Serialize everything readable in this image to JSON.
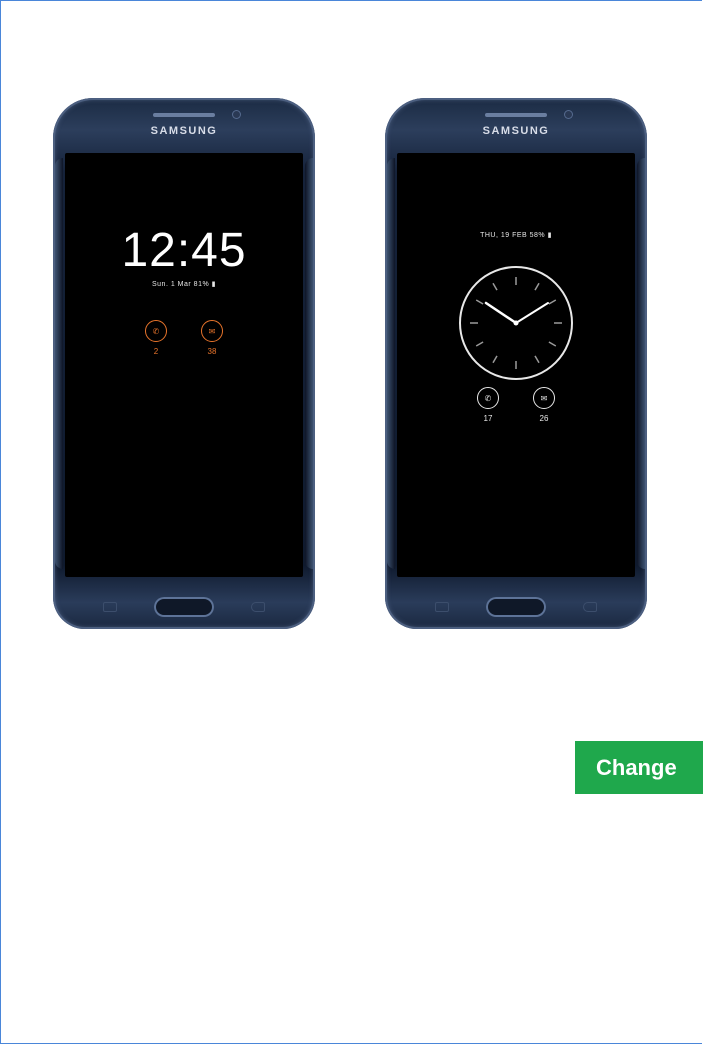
{
  "phones": [
    {
      "brand": "SAMSUNG",
      "clock": "12:45",
      "status": "Sun. 1 Mar  81% ▮",
      "notifications": [
        {
          "icon": "missed-call-icon",
          "glyph": "✆",
          "count": "2"
        },
        {
          "icon": "message-icon",
          "glyph": "✉",
          "count": "38"
        }
      ]
    },
    {
      "brand": "SAMSUNG",
      "status": "THU, 19 FEB  58% ▮",
      "notifications": [
        {
          "icon": "missed-call-icon",
          "glyph": "✆",
          "count": "17"
        },
        {
          "icon": "message-icon",
          "glyph": "✉",
          "count": "26"
        }
      ]
    }
  ],
  "actions": {
    "change_label": "Change"
  },
  "colors": {
    "accent_green": "#1fa84c",
    "notification_orange": "#e8742b",
    "frame_border": "#4a86d9"
  }
}
